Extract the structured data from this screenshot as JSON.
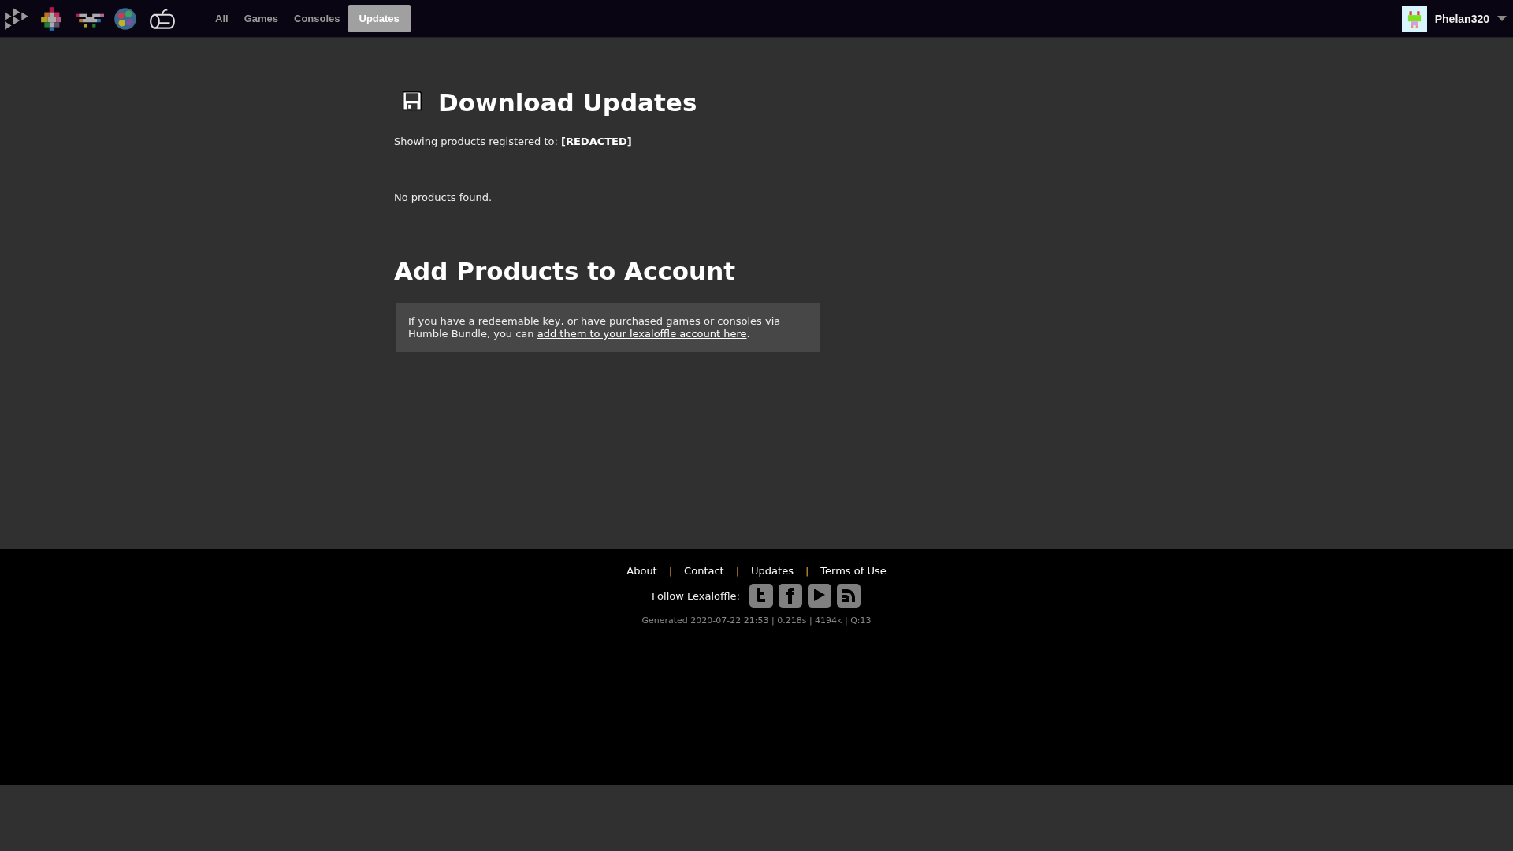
{
  "nav": {
    "tabs": [
      {
        "label": "All",
        "selected": false
      },
      {
        "label": "Games",
        "selected": false
      },
      {
        "label": "Consoles",
        "selected": false
      },
      {
        "label": "Updates",
        "selected": true
      }
    ],
    "user": {
      "name": "Phelan320"
    }
  },
  "main": {
    "title": "Download Updates",
    "registered_label": "Showing products registered to:",
    "registered_value": "[REDACTED]",
    "empty_message": "No products found.",
    "add_title": "Add Products to Account",
    "add_text": "If you have a redeemable key, or have purchased games or consoles via Humble Bundle, you can ",
    "add_link": "add them to your lexaloffle account here",
    "add_end": "."
  },
  "footer": {
    "links": [
      "About",
      "Contact",
      "Updates",
      "Terms of Use"
    ],
    "separator": "|",
    "follow_label": "Follow Lexaloffle:",
    "generated": "Generated 2020-07-22 21:53 | 0.218s | 4194k | Q:13"
  }
}
